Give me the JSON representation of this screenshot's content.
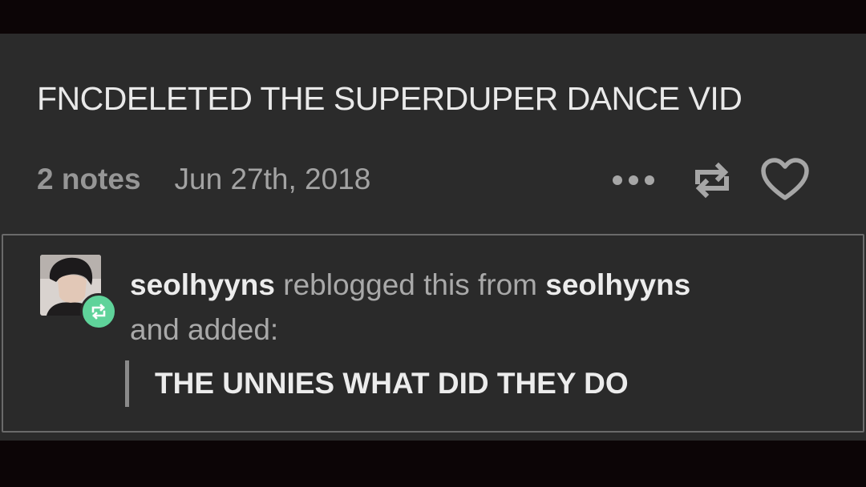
{
  "post": {
    "body": "FNCDELETED THE SUPERDUPER DANCE VID",
    "notes": "2 notes",
    "date": "Jun 27th, 2018",
    "actions": {
      "more_icon": "ellipsis-icon",
      "reblog_icon": "reblog-icon",
      "like_icon": "heart-icon"
    }
  },
  "reblog": {
    "user": "seolhyyns",
    "verb": "reblogged this from",
    "source_user": "seolhyyns",
    "suffix": "and added:",
    "comment": "THE UNNIES WHAT DID THEY DO",
    "badge_icon": "reblog-icon",
    "badge_color": "#5fd39a"
  },
  "colors": {
    "background": "#0c0506",
    "card": "#2b2b2b",
    "text_primary": "#e9e9e9",
    "text_muted": "#8f8f8f"
  }
}
